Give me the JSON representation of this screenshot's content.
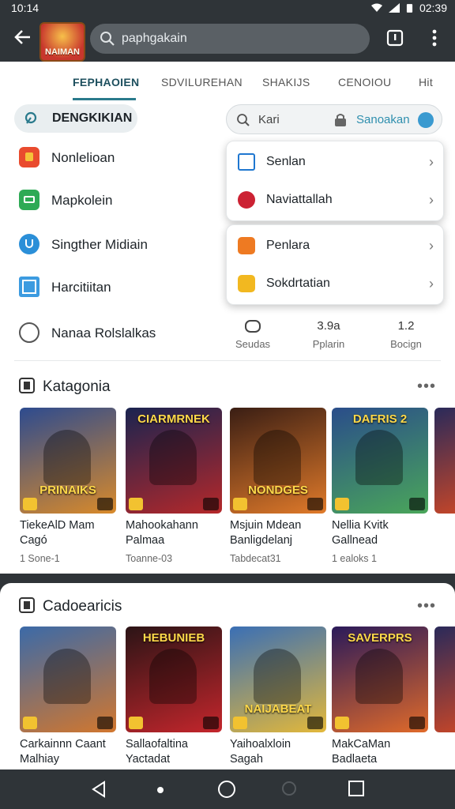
{
  "status": {
    "time": "10:14",
    "battery_time": "02:39"
  },
  "appbar": {
    "search_text": "paphgakain",
    "logo_text": "NAIMAN"
  },
  "tabs": [
    {
      "label": "FEPHAOIEN",
      "active": true
    },
    {
      "label": "SDVILUREHAN",
      "active": false
    },
    {
      "label": "SHAKIJS",
      "active": false
    },
    {
      "label": "CENOIOU",
      "active": false
    },
    {
      "label": "Hit",
      "active": false
    }
  ],
  "chip": {
    "label": "DENGKIKIAN"
  },
  "search2": {
    "placeholder": "Kari",
    "right_label": "Sanoakan"
  },
  "menu": [
    {
      "label": "Nonlelioan",
      "icon": "app-red-icon",
      "color": "#e94b2e"
    },
    {
      "label": "Mapkolein",
      "icon": "app-green-icon",
      "color": "#2eaa55"
    },
    {
      "label": "Singther Midiain",
      "icon": "shield-blue-icon",
      "color": "#2b8fd8"
    },
    {
      "label": "Harcitiitan",
      "icon": "image-blue-icon",
      "color": "#3c9be0"
    },
    {
      "label": "Nanaa Rolslalkas",
      "icon": "face-outline-icon",
      "color": "#555555"
    }
  ],
  "popup1": [
    {
      "label": "Senlan",
      "icon": "bookmark-blue-icon",
      "color": "#1f77d0"
    },
    {
      "label": "Naviattallah",
      "icon": "heart-red-icon",
      "color": "#cc2233"
    }
  ],
  "popup2": [
    {
      "label": "Penlara",
      "icon": "card-orange-icon",
      "color": "#ee7a22"
    },
    {
      "label": "Sokdrtatian",
      "icon": "grid-yellow-icon",
      "color": "#f2b820"
    }
  ],
  "stats": [
    {
      "value": "",
      "label": "Seudas",
      "icon": "gamepad-icon"
    },
    {
      "value": "3.9a",
      "label": "Pplarin"
    },
    {
      "value": "1.2",
      "label": "Bocign"
    }
  ],
  "section1": {
    "title": "Katagonia",
    "more": "•••",
    "cards": [
      {
        "art_text": "PRINAIKS",
        "name": "TiekeAlD Mam Cagó",
        "meta": "1 Sone-1",
        "bg1": "#2d4b8f",
        "bg2": "#d98a2a"
      },
      {
        "art_text": "CIARMRNEK",
        "name": "Mahookahann Palmaa",
        "meta": "Toanne-03",
        "bg1": "#1a2450",
        "bg2": "#b5282a"
      },
      {
        "art_text": "NONDGES",
        "name": "Msjuin Mdean Banligdelanj",
        "meta": "Tabdecat31",
        "bg1": "#3a1e14",
        "bg2": "#e07a2a"
      },
      {
        "art_text": "DAFRIS 2",
        "name": "Nellia Kvitk Gallnead",
        "meta": "1 ealoks 1",
        "bg1": "#2a4d8a",
        "bg2": "#4aa65a"
      }
    ]
  },
  "section2": {
    "title": "Cadoearicis",
    "more": "•••",
    "cards": [
      {
        "art_text": "",
        "name": "Carkainnn Caant Malhiay",
        "bg1": "#3b6aa8",
        "bg2": "#d2772e"
      },
      {
        "art_text": "HEBUNIEB",
        "name": "Sallaofaltina Yactadat",
        "bg1": "#2b1416",
        "bg2": "#c4262c"
      },
      {
        "art_text": "NAIJABEAT",
        "name": "Yaihoalxloin Sagah",
        "bg1": "#3a6fb5",
        "bg2": "#e3b83a"
      },
      {
        "art_text": "SAVERPRS",
        "name": "MakCaMan Badlaeta",
        "bg1": "#2a1a5a",
        "bg2": "#e06a2a"
      }
    ]
  }
}
